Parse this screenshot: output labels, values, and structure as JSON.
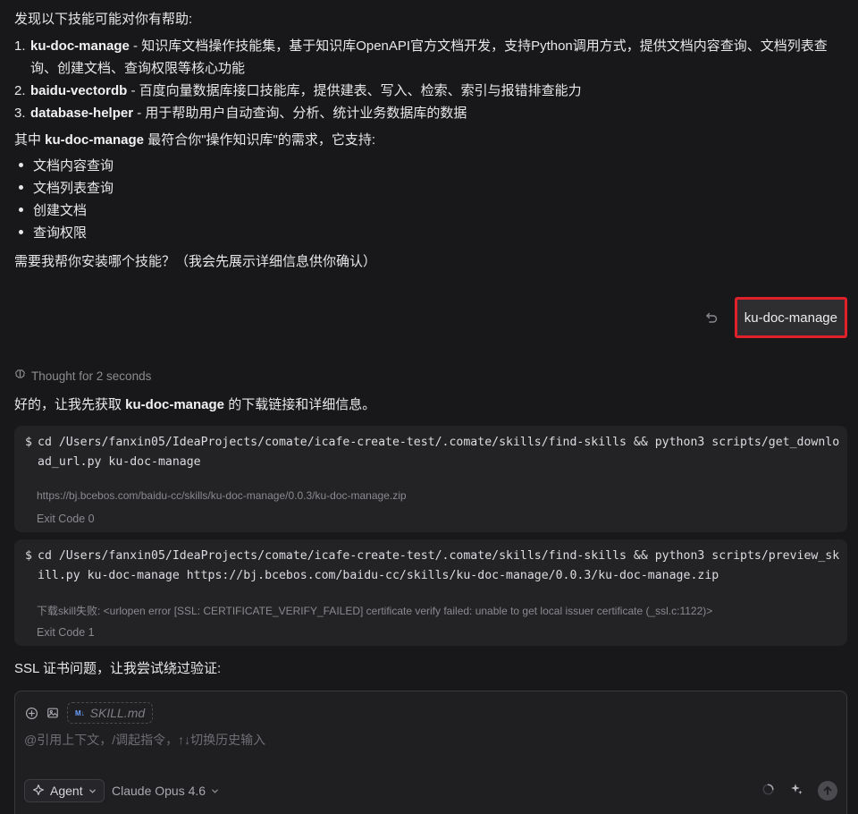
{
  "messages": {
    "intro": "发现以下技能可能对你有帮助:",
    "skills": [
      {
        "num": "1.",
        "name": "ku-doc-manage",
        "desc": " - 知识库文档操作技能集，基于知识库OpenAPI官方文档开发，支持Python调用方式，提供文档内容查询、文档列表查询、创建文档、查询权限等核心功能"
      },
      {
        "num": "2.",
        "name": "baidu-vectordb",
        "desc": " - 百度向量数据库接口技能库，提供建表、写入、检索、索引与报错排查能力"
      },
      {
        "num": "3.",
        "name": "database-helper",
        "desc": " - 用于帮助用户自动查询、分析、统计业务数据库的数据"
      }
    ],
    "recommend_prefix": "其中 ",
    "recommend_name": "ku-doc-manage",
    "recommend_suffix": " 最符合你\"操作知识库\"的需求，它支持:",
    "features": [
      "文档内容查询",
      "文档列表查询",
      "创建文档",
      "查询权限"
    ],
    "question": "需要我帮你安装哪个技能？（我会先展示详细信息供你确认）"
  },
  "user_message": "ku-doc-manage",
  "thought": "Thought for 2 seconds",
  "reply": {
    "prefix": "好的，让我先获取 ",
    "name": "ku-doc-manage",
    "suffix": " 的下载链接和详细信息。"
  },
  "commands": [
    {
      "prompt": "$",
      "command": "cd /Users/fanxin05/IdeaProjects/comate/icafe-create-test/.comate/skills/find-skills && python3 scripts/get_download_url.py ku-doc-manage",
      "output": "https://bj.bcebos.com/baidu-cc/skills/ku-doc-manage/0.0.3/ku-doc-manage.zip",
      "exit": "Exit Code 0"
    },
    {
      "prompt": "$",
      "command": "cd /Users/fanxin05/IdeaProjects/comate/icafe-create-test/.comate/skills/find-skills && python3 scripts/preview_skill.py ku-doc-manage https://bj.bcebos.com/baidu-cc/skills/ku-doc-manage/0.0.3/ku-doc-manage.zip",
      "output": "下载skill失败: <urlopen error [SSL: CERTIFICATE_VERIFY_FAILED] certificate verify failed: unable to get local issuer certificate (_ssl.c:1122)>",
      "exit": "Exit Code 1"
    }
  ],
  "ssl_note": "SSL 证书问题，让我尝试绕过验证:",
  "composer": {
    "chip": "SKILL.md",
    "chip_icon": "M↓",
    "placeholder": "@引用上下文，/调起指令，↑↓切换历史输入",
    "mode": "Agent",
    "model": "Claude Opus 4.6"
  },
  "colors": {
    "background": "#18181a",
    "highlight_border": "#e0202a",
    "code_block": "#232326"
  }
}
